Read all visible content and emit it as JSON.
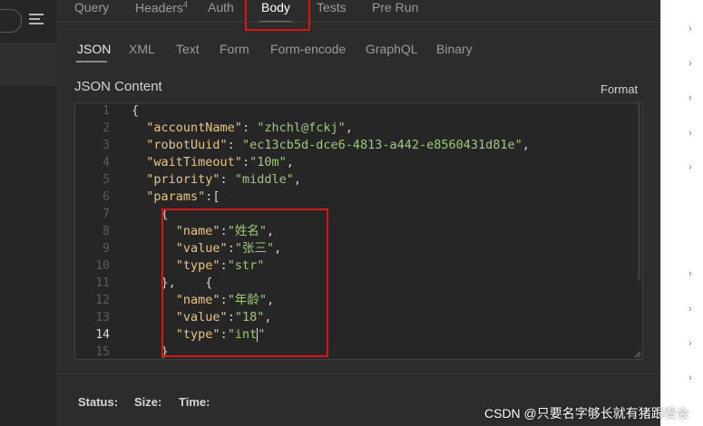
{
  "tabs": {
    "query": "Query",
    "headers": "Headers",
    "headers_count": "4",
    "auth": "Auth",
    "body": "Body",
    "tests": "Tests",
    "pre_run": "Pre Run"
  },
  "body_types": [
    "JSON",
    "XML",
    "Text",
    "Form",
    "Form-encode",
    "GraphQL",
    "Binary"
  ],
  "active_body_type": "JSON",
  "editor": {
    "title": "JSON Content",
    "format_label": "Format",
    "line_numbers": [
      "1",
      "2",
      "3",
      "4",
      "5",
      "6",
      "7",
      "8",
      "9",
      "10",
      "11",
      "12",
      "13",
      "14",
      "15"
    ],
    "current_line": "14",
    "lines": [
      [
        [
          "p",
          "{"
        ]
      ],
      [
        [
          "p",
          "  "
        ],
        [
          "k",
          "\"accountName\""
        ],
        [
          "p",
          ": "
        ],
        [
          "v",
          "\"zhchl@fckj\""
        ],
        [
          "p",
          ","
        ]
      ],
      [
        [
          "p",
          "  "
        ],
        [
          "k",
          "\"robotUuid\""
        ],
        [
          "p",
          ": "
        ],
        [
          "v",
          "\"ec13cb5d-dce6-4813-a442-e8560431d81e\""
        ],
        [
          "p",
          ","
        ]
      ],
      [
        [
          "p",
          "  "
        ],
        [
          "k",
          "\"waitTimeout\""
        ],
        [
          "p",
          ":"
        ],
        [
          "v",
          "\"10m\""
        ],
        [
          "p",
          ","
        ]
      ],
      [
        [
          "p",
          "  "
        ],
        [
          "k",
          "\"priority\""
        ],
        [
          "p",
          ": "
        ],
        [
          "v",
          "\"middle\""
        ],
        [
          "p",
          ","
        ]
      ],
      [
        [
          "p",
          "  "
        ],
        [
          "k",
          "\"params\""
        ],
        [
          "p",
          ":["
        ]
      ],
      [
        [
          "p",
          "    {"
        ]
      ],
      [
        [
          "p",
          "      "
        ],
        [
          "k",
          "\"name\""
        ],
        [
          "p",
          ":"
        ],
        [
          "v",
          "\"姓名\""
        ],
        [
          "p",
          ","
        ]
      ],
      [
        [
          "p",
          "      "
        ],
        [
          "k",
          "\"value\""
        ],
        [
          "p",
          ":"
        ],
        [
          "v",
          "\"张三\""
        ],
        [
          "p",
          ","
        ]
      ],
      [
        [
          "p",
          "      "
        ],
        [
          "k",
          "\"type\""
        ],
        [
          "p",
          ":"
        ],
        [
          "v",
          "\"str\""
        ]
      ],
      [
        [
          "p",
          "    },    {"
        ]
      ],
      [
        [
          "p",
          "      "
        ],
        [
          "k",
          "\"name\""
        ],
        [
          "p",
          ":"
        ],
        [
          "v",
          "\"年龄\""
        ],
        [
          "p",
          ","
        ]
      ],
      [
        [
          "p",
          "      "
        ],
        [
          "k",
          "\"value\""
        ],
        [
          "p",
          ":"
        ],
        [
          "v",
          "\"18\""
        ],
        [
          "p",
          ","
        ]
      ],
      [
        [
          "p",
          "      "
        ],
        [
          "k",
          "\"type\""
        ],
        [
          "p",
          ":"
        ],
        [
          "v",
          "\"int"
        ],
        [
          "c",
          ""
        ],
        [
          "v",
          "\""
        ]
      ],
      [
        [
          "p",
          "    }"
        ]
      ]
    ]
  },
  "status": {
    "status_label": "Status:",
    "size_label": "Size:",
    "time_label": "Time:"
  },
  "watermark": "CSDN @只要名字够长就有猪跟看会",
  "icons": {
    "menu": "hamburger-menu-icon",
    "search": "search-pill-icon",
    "chevron": "chevron-right-icon"
  },
  "colors": {
    "highlight": "#dd1414",
    "json_key": "#e7c587",
    "json_string": "#9fc87a"
  }
}
